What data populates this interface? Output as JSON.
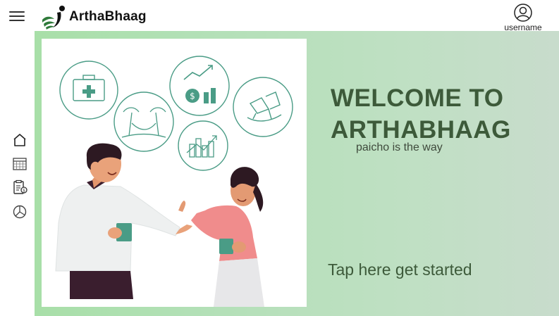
{
  "header": {
    "brand_name": "ArthaBhaag",
    "username_label": "username",
    "menu_icon": "hamburger-menu-icon",
    "user_icon": "user-avatar-icon"
  },
  "sidebar": {
    "items": [
      {
        "icon": "home-icon"
      },
      {
        "icon": "calendar-icon"
      },
      {
        "icon": "clipboard-bill-icon"
      },
      {
        "icon": "pie-chart-icon"
      }
    ]
  },
  "hero": {
    "title": "WELCOME TO ARTHABHAAG",
    "tagline": "paicho is the way",
    "cta_label": "Tap here get started"
  },
  "colors": {
    "accent_green": "#4a9c86",
    "title_green": "#3d5a3a",
    "background_green": "#b2e0b6"
  }
}
